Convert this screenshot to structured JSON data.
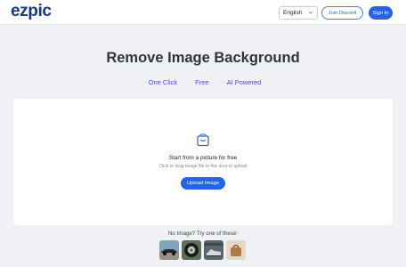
{
  "header": {
    "logo": "ezpic",
    "language": "English",
    "join_discord": "Join Discord",
    "sign_in": "Sign In"
  },
  "main": {
    "title": "Remove Image Background",
    "features": [
      "One Click",
      "Free",
      "AI Powered"
    ]
  },
  "upload": {
    "title": "Start from a picture for free",
    "subtitle": "Click or drag image file to this area to upload",
    "button": "Upload Image"
  },
  "samples": {
    "label": "No Image? Try one of these:",
    "items": [
      "car-sample",
      "tire-sample",
      "shoes-sample",
      "bag-sample"
    ]
  },
  "icons": {
    "upload": "bag-icon",
    "language": "chevron-down-icon"
  },
  "colors": {
    "brand": "#163a80",
    "primary": "#2563eb",
    "accent_text": "#4f46e5",
    "background": "#eff1f4"
  }
}
